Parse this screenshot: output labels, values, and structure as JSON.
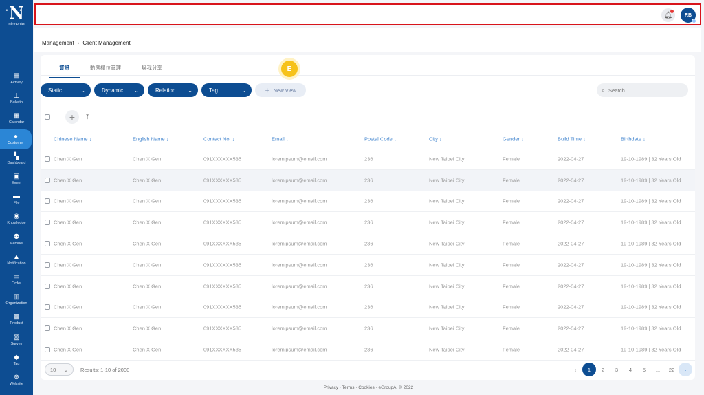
{
  "logo": {
    "mark": "N",
    "text": "Infocenter"
  },
  "nav": [
    {
      "label": "Activity",
      "icon": "activity-icon",
      "glyph": "▤",
      "active": false
    },
    {
      "label": "Bulletin",
      "icon": "pin-icon",
      "glyph": "⊥",
      "active": false
    },
    {
      "label": "Calendar",
      "icon": "calendar-icon",
      "glyph": "▦",
      "active": false
    },
    {
      "label": "Customer",
      "icon": "customer-icon",
      "glyph": "●",
      "active": true
    },
    {
      "label": "Dashboard",
      "icon": "dashboard-icon",
      "glyph": "▚",
      "active": false
    },
    {
      "label": "Event",
      "icon": "event-icon",
      "glyph": "▣",
      "active": false
    },
    {
      "label": "File",
      "icon": "file-icon",
      "glyph": "▬",
      "active": false
    },
    {
      "label": "Knowledge",
      "icon": "bulb-icon",
      "glyph": "◉",
      "active": false
    },
    {
      "label": "Member",
      "icon": "member-icon",
      "glyph": "⚉",
      "active": false
    },
    {
      "label": "Notification",
      "icon": "bell-icon",
      "glyph": "▲",
      "active": false
    },
    {
      "label": "Order",
      "icon": "order-icon",
      "glyph": "▭",
      "active": false
    },
    {
      "label": "Organization",
      "icon": "organization-icon",
      "glyph": "▥",
      "active": false
    },
    {
      "label": "Product",
      "icon": "product-icon",
      "glyph": "▩",
      "active": false
    },
    {
      "label": "Survey",
      "icon": "survey-icon",
      "glyph": "▨",
      "active": false
    },
    {
      "label": "Tag",
      "icon": "tag-icon",
      "glyph": "◆",
      "active": false
    },
    {
      "label": "Website",
      "icon": "globe-icon",
      "glyph": "⊕",
      "active": false
    }
  ],
  "topbar": {
    "avatar": "RB"
  },
  "breadcrumb": {
    "parent": "Management",
    "current": "Client Management"
  },
  "tabs": [
    {
      "label": "資訊",
      "active": true
    },
    {
      "label": "動態欄位管理",
      "active": false
    },
    {
      "label": "與我分享",
      "active": false
    }
  ],
  "badge": "E",
  "filters": [
    "Static",
    "Dynamic",
    "Relation",
    "Tag"
  ],
  "new_view": "New View",
  "search": {
    "placeholder": "Search"
  },
  "columns": [
    "Chinese Name ↓",
    "English  Name ↓",
    "Contact No. ↓",
    "Email ↓",
    "Postal Code ↓",
    "City ↓",
    "Gender ↓",
    "Build Time ↓",
    "Birthdate ↓"
  ],
  "rows": [
    [
      "Chen X Gen",
      "Chen X Gen",
      "091XXXXXX535",
      "loremipsum@email.com",
      "236",
      "New Taipei City",
      "Female",
      "2022-04-27",
      "19-10-1989 | 32 Years Old"
    ],
    [
      "Chen X Gen",
      "Chen X Gen",
      "091XXXXXX535",
      "loremipsum@email.com",
      "236",
      "New Taipei City",
      "Female",
      "2022-04-27",
      "19-10-1989 | 32 Years Old"
    ],
    [
      "Chen X Gen",
      "Chen X Gen",
      "091XXXXXX535",
      "loremipsum@email.com",
      "236",
      "New Taipei City",
      "Female",
      "2022-04-27",
      "19-10-1989 | 32 Years Old"
    ],
    [
      "Chen X Gen",
      "Chen X Gen",
      "091XXXXXX535",
      "loremipsum@email.com",
      "236",
      "New Taipei City",
      "Female",
      "2022-04-27",
      "19-10-1989 | 32 Years Old"
    ],
    [
      "Chen X Gen",
      "Chen X Gen",
      "091XXXXXX535",
      "loremipsum@email.com",
      "236",
      "New Taipei City",
      "Female",
      "2022-04-27",
      "19-10-1989 | 32 Years Old"
    ],
    [
      "Chen X Gen",
      "Chen X Gen",
      "091XXXXXX535",
      "loremipsum@email.com",
      "236",
      "New Taipei City",
      "Female",
      "2022-04-27",
      "19-10-1989 | 32 Years Old"
    ],
    [
      "Chen X Gen",
      "Chen X Gen",
      "091XXXXXX535",
      "loremipsum@email.com",
      "236",
      "New Taipei City",
      "Female",
      "2022-04-27",
      "19-10-1989 | 32 Years Old"
    ],
    [
      "Chen X Gen",
      "Chen X Gen",
      "091XXXXXX535",
      "loremipsum@email.com",
      "236",
      "New Taipei City",
      "Female",
      "2022-04-27",
      "19-10-1989 | 32 Years Old"
    ],
    [
      "Chen X Gen",
      "Chen X Gen",
      "091XXXXXX535",
      "loremipsum@email.com",
      "236",
      "New Taipei City",
      "Female",
      "2022-04-27",
      "19-10-1989 | 32 Years Old"
    ],
    [
      "Chen X Gen",
      "Chen X Gen",
      "091XXXXXX535",
      "loremipsum@email.com",
      "236",
      "New Taipei City",
      "Female",
      "2022-04-27",
      "19-10-1989 | 32 Years Old"
    ]
  ],
  "highlighted_row": 1,
  "pagination": {
    "page_size": "10",
    "results": "Results: 1-10 of 2000",
    "pages": [
      "1",
      "2",
      "3",
      "4",
      "5",
      "...",
      "22"
    ],
    "current": "1"
  },
  "footer": "Privacy · Terms · Cookies · eGroupAI © 2022"
}
